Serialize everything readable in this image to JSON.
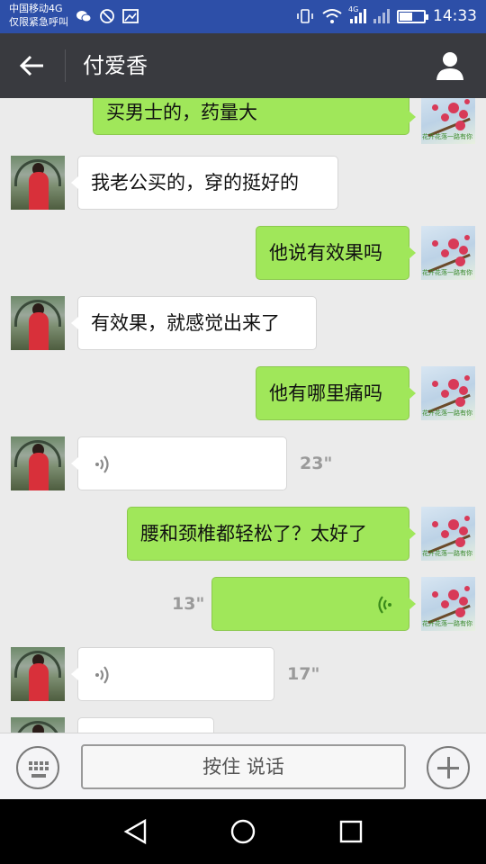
{
  "status_bar": {
    "carrier_line1": "中国移动4G",
    "carrier_line2": "仅限紧急呼叫",
    "network": "4G",
    "time": "14:33",
    "battery_level": 0.55
  },
  "header": {
    "title": "付爱香"
  },
  "messages": [
    {
      "side": "right",
      "type": "text",
      "text": "买男士的，药量大"
    },
    {
      "side": "left",
      "type": "text",
      "text": "我老公买的，穿的挺好的"
    },
    {
      "side": "right",
      "type": "text",
      "text": "他说有效果吗"
    },
    {
      "side": "left",
      "type": "text",
      "text": "有效果，就感觉出来了"
    },
    {
      "side": "right",
      "type": "text",
      "text": "他有哪里痛吗"
    },
    {
      "side": "left",
      "type": "voice",
      "duration": "23\""
    },
    {
      "side": "right",
      "type": "text",
      "text": "腰和颈椎都轻松了？太好了"
    },
    {
      "side": "right",
      "type": "voice",
      "duration": "13\""
    },
    {
      "side": "left",
      "type": "voice",
      "duration": "17\""
    }
  ],
  "avatar_caption": "花开花落一路有你",
  "input_bar": {
    "hold_to_talk_label": "按住 说话"
  },
  "colors": {
    "status_bar": "#2d4fa8",
    "title_bar": "#393a3f",
    "chat_bg": "#ebebeb",
    "bubble_sent": "#a0e75a",
    "bubble_received": "#ffffff"
  },
  "icons": {
    "back": "arrow-left-icon",
    "profile": "person-icon",
    "keyboard": "keyboard-icon",
    "plus": "plus-icon",
    "voice": "voice-wave-icon"
  }
}
